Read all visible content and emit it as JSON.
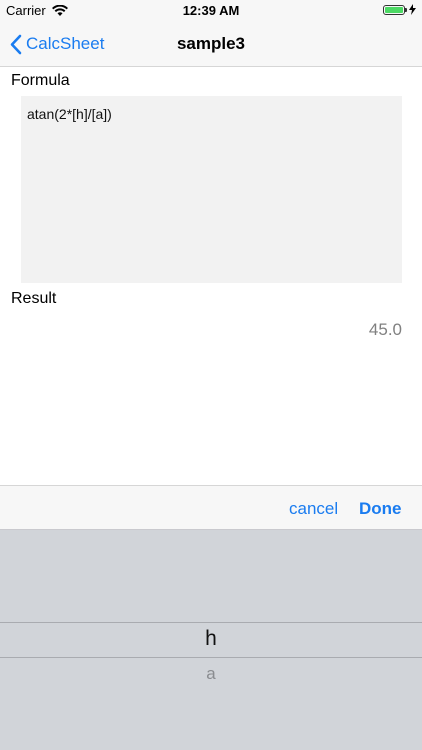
{
  "status_bar": {
    "carrier": "Carrier",
    "time": "12:39 AM"
  },
  "nav": {
    "back_label": "CalcSheet",
    "title": "sample3"
  },
  "formula": {
    "label": "Formula",
    "value": "atan(2*[h]/[a])"
  },
  "result": {
    "label": "Result",
    "value": "45.0"
  },
  "toolbar": {
    "cancel_label": "cancel",
    "done_label": "Done"
  },
  "picker": {
    "selected": "h",
    "next": "a"
  },
  "colors": {
    "accent": "#1a7cf0",
    "battery": "#4cd964",
    "picker_bg": "#d1d4d9"
  }
}
